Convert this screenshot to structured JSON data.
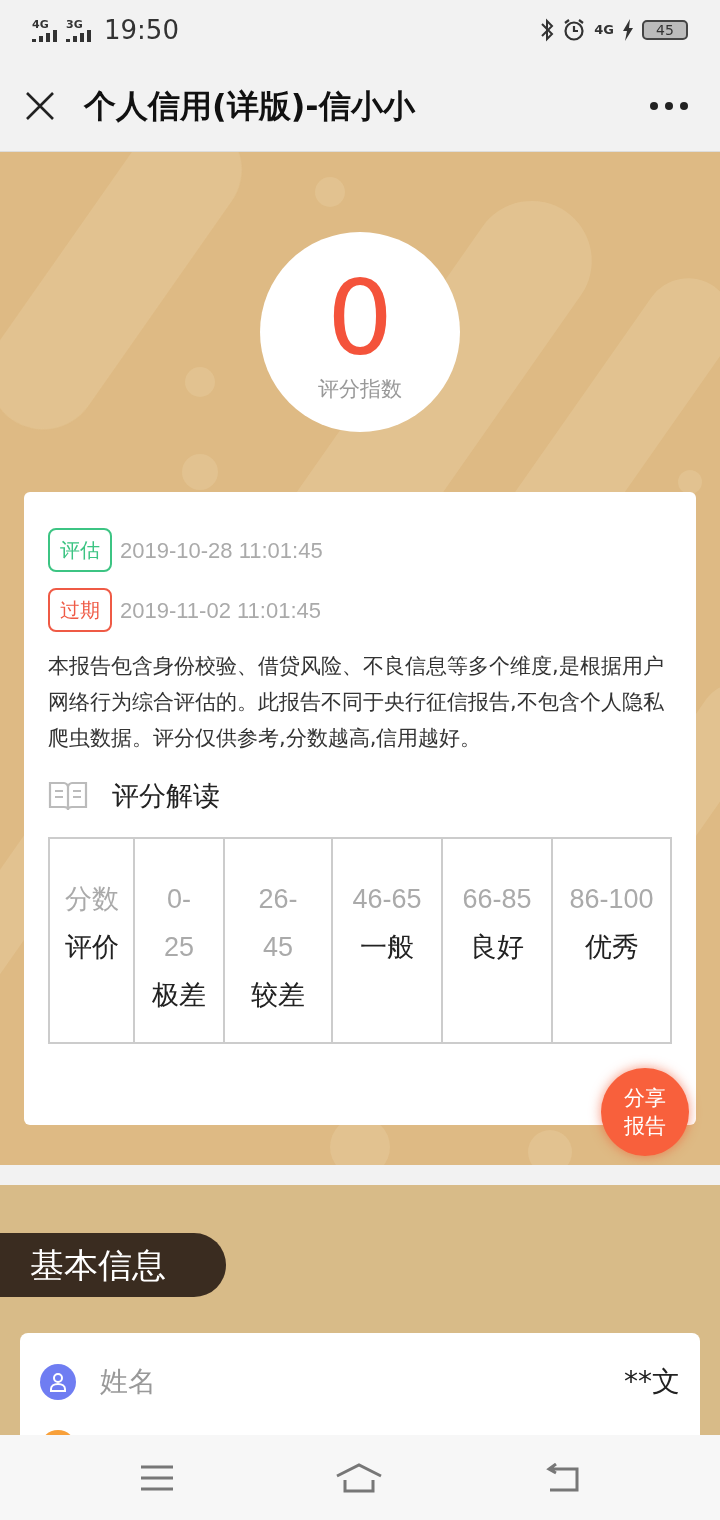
{
  "status_bar": {
    "networks": [
      "4G",
      "3G"
    ],
    "time": "19:50",
    "right_network": "4G",
    "battery": "45"
  },
  "header": {
    "title": "个人信用(详版)-信小小"
  },
  "score": {
    "value": "0",
    "label": "评分指数"
  },
  "dates": [
    {
      "kind": "evaluated",
      "tag": "评估",
      "date": "2019-10-28 11:01:45"
    },
    {
      "kind": "expired",
      "tag": "过期",
      "date": "2019-11-02 11:01:45"
    }
  ],
  "description": "本报告包含身份校验、借贷风险、不良信息等多个维度,是根据用户网络行为综合评估的。此报告不同于央行征信报告,不包含个人隐私爬虫数据。评分仅供参考,分数越高,信用越好。",
  "interpretation": {
    "title": "评分解读",
    "columns": [
      {
        "range": "分数",
        "rating": "评价"
      },
      {
        "range": "0-25",
        "rating": "极差"
      },
      {
        "range": "26-45",
        "rating": "较差"
      },
      {
        "range": "46-65",
        "rating": "一般"
      },
      {
        "range": "66-85",
        "rating": "良好"
      },
      {
        "range": "86-100",
        "rating": "优秀"
      }
    ]
  },
  "share_button": "分享报告",
  "basic_info": {
    "title": "基本信息",
    "rows": [
      {
        "label": "姓名",
        "value": "**文",
        "color": "#6f7df2"
      },
      {
        "color": "#f8a03a"
      }
    ]
  }
}
